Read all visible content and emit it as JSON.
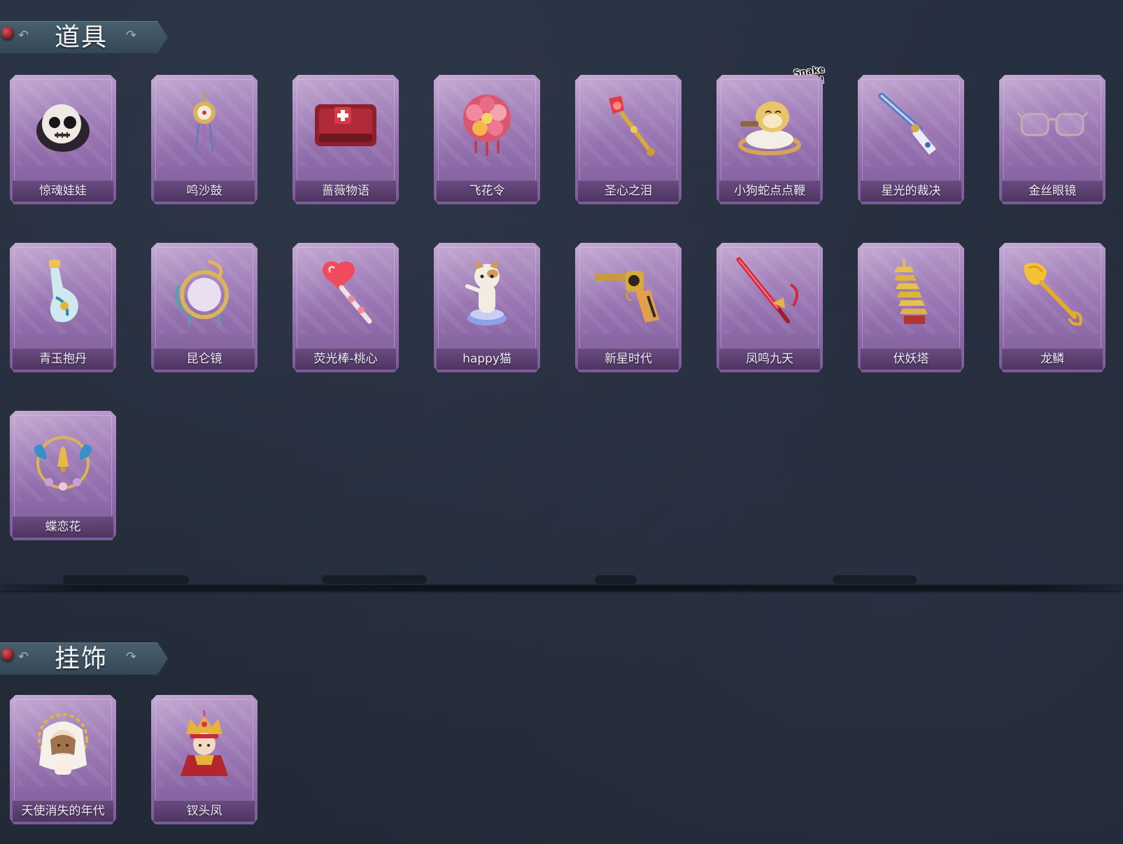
{
  "sections": [
    {
      "title": "道具"
    },
    {
      "title": "挂饰"
    }
  ],
  "items": {
    "props": [
      {
        "label": "惊魂娃娃",
        "icon": "skull-doll-icon"
      },
      {
        "label": "鸣沙鼓",
        "icon": "drum-ornament-icon"
      },
      {
        "label": "蔷薇物语",
        "icon": "medkit-box-icon"
      },
      {
        "label": "飞花令",
        "icon": "flower-bouquet-icon"
      },
      {
        "label": "圣心之泪",
        "icon": "heart-scepter-icon"
      },
      {
        "label": "小狗蛇点点鞭",
        "icon": "snake-whip-icon",
        "sticker": "Snake Spot!"
      },
      {
        "label": "星光的裁决",
        "icon": "flintlock-gun-icon"
      },
      {
        "label": "金丝眼镜",
        "icon": "glasses-icon"
      },
      {
        "label": "青玉抱丹",
        "icon": "jade-vase-icon"
      },
      {
        "label": "昆仑镜",
        "icon": "ornate-mirror-icon"
      },
      {
        "label": "荧光棒-桃心",
        "icon": "heart-wand-icon"
      },
      {
        "label": "happy猫",
        "icon": "cat-figure-icon"
      },
      {
        "label": "新星时代",
        "icon": "revolver-icon"
      },
      {
        "label": "凤鸣九天",
        "icon": "red-sword-icon"
      },
      {
        "label": "伏妖塔",
        "icon": "pagoda-icon"
      },
      {
        "label": "龙鳞",
        "icon": "golden-shovel-icon"
      },
      {
        "label": "蝶恋花",
        "icon": "butterfly-bell-icon"
      }
    ],
    "pendants": [
      {
        "label": "天使消失的年代",
        "icon": "angel-doll-icon"
      },
      {
        "label": "钗头凤",
        "icon": "phoenix-crown-doll-icon"
      }
    ]
  },
  "colors": {
    "background": "#232b39",
    "card_purple": "#9a77b4",
    "label_bar": "#5a3f70",
    "banner": "#3f5361"
  }
}
